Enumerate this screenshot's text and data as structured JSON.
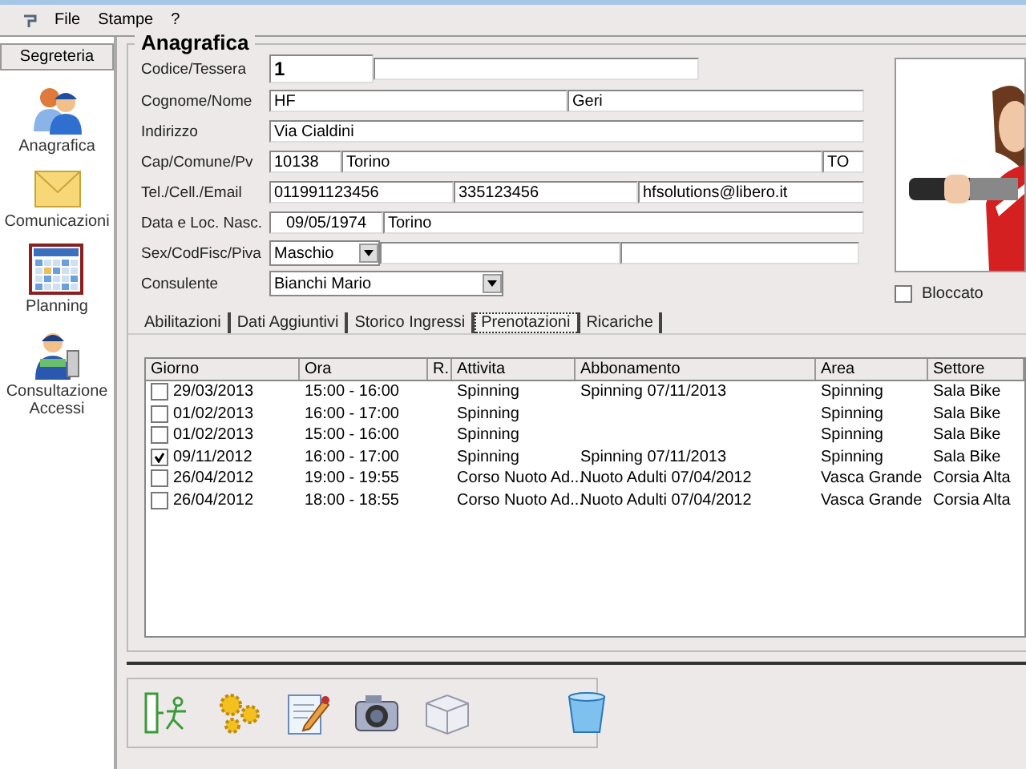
{
  "menu": [
    "File",
    "Stampe",
    "?"
  ],
  "sidebar": {
    "title": "Segreteria",
    "items": [
      {
        "label": "Anagrafica",
        "kind": "people"
      },
      {
        "label": "Comunicazioni",
        "kind": "mail"
      },
      {
        "label": "Planning",
        "kind": "calendar"
      },
      {
        "label": "Consultazione Accessi",
        "kind": "access"
      }
    ]
  },
  "section_title": "Anagrafica",
  "form": [
    {
      "label": "Codice/Tessera",
      "fields": [
        {
          "value": "1"
        },
        {
          "kind": "blank"
        }
      ]
    },
    {
      "label": "Cognome/Nome",
      "fields": [
        {
          "value": "HF"
        },
        {
          "value": "Geri"
        }
      ]
    },
    {
      "label": "Indirizzo",
      "fields": [
        {
          "value": "Via Cialdini"
        }
      ]
    },
    {
      "label": "Cap/Comune/Pv",
      "fields": [
        {
          "value": "10138"
        },
        {
          "value": "Torino"
        },
        {
          "value": "TO"
        }
      ]
    },
    {
      "label": "Tel./Cell./Email",
      "fields": [
        {
          "value": "011991123456"
        },
        {
          "value": "335123456"
        },
        {
          "value": "hfsolutions@libero.it"
        }
      ]
    },
    {
      "label": "Data e Loc. Nasc.",
      "fields": [
        {
          "value": "09/05/1974",
          "kind": "date"
        },
        {
          "value": "Torino"
        }
      ]
    },
    {
      "label": "Sex/CodFisc/Piva",
      "fields": [
        {
          "value": "Maschio",
          "kind": "combo"
        },
        {
          "kind": "blank"
        },
        {
          "kind": "blank"
        }
      ]
    },
    {
      "label": "Consulente",
      "fields": [
        {
          "value": "Bianchi Mario",
          "kind": "combo"
        }
      ]
    }
  ],
  "photo": {
    "kind": "picture"
  },
  "blocked": {
    "label": "Bloccato",
    "checked": false
  },
  "tabs": [
    {
      "label": "Abilitazioni",
      "selected": false
    },
    {
      "label": "Dati Aggiuntivi",
      "selected": false
    },
    {
      "label": "Storico Ingressi",
      "selected": false
    },
    {
      "label": "Prenotazioni",
      "selected": true
    },
    {
      "label": "Ricariche",
      "selected": false
    }
  ],
  "table": {
    "columns": [
      "Giorno",
      "Ora",
      "R.",
      "Attivita",
      "Abbonamento",
      "Area",
      "Settore"
    ],
    "rows": [
      {
        "checked": false,
        "giorno": "29/03/2013",
        "ora": "15:00 - 16:00",
        "attivita": "Spinning",
        "abbonamento": "Spinning 07/11/2013",
        "area": "Spinning",
        "settore": "Sala Bike"
      },
      {
        "checked": false,
        "giorno": "01/02/2013",
        "ora": "16:00 - 17:00",
        "attivita": "Spinning",
        "area": "Spinning",
        "settore": "Sala Bike"
      },
      {
        "checked": false,
        "giorno": "01/02/2013",
        "ora": "15:00 - 16:00",
        "attivita": "Spinning",
        "area": "Spinning",
        "settore": "Sala Bike"
      },
      {
        "checked": true,
        "giorno": "09/11/2012",
        "ora": "16:00 - 17:00",
        "attivita": "Spinning",
        "abbonamento": "Spinning 07/11/2013",
        "area": "Spinning",
        "settore": "Sala Bike"
      },
      {
        "checked": false,
        "giorno": "26/04/2012",
        "ora": "19:00 - 19:55",
        "attivita": "Corso Nuoto Ad...",
        "abbonamento": "Nuoto Adulti 07/04/2012",
        "area": "Vasca Grande",
        "settore": "Corsia Alta"
      },
      {
        "checked": false,
        "giorno": "26/04/2012",
        "ora": "18:00 - 18:55",
        "attivita": "Corso Nuoto Ad...",
        "abbonamento": "Nuoto Adulti 07/04/2012",
        "area": "Vasca Grande",
        "settore": "Corsia Alta"
      }
    ]
  },
  "toolbar": [
    {
      "kind": "exit"
    },
    {
      "kind": "sun"
    },
    {
      "kind": "edit"
    },
    {
      "kind": "camera"
    },
    {
      "kind": "box"
    },
    {
      "kind": "bin"
    }
  ]
}
